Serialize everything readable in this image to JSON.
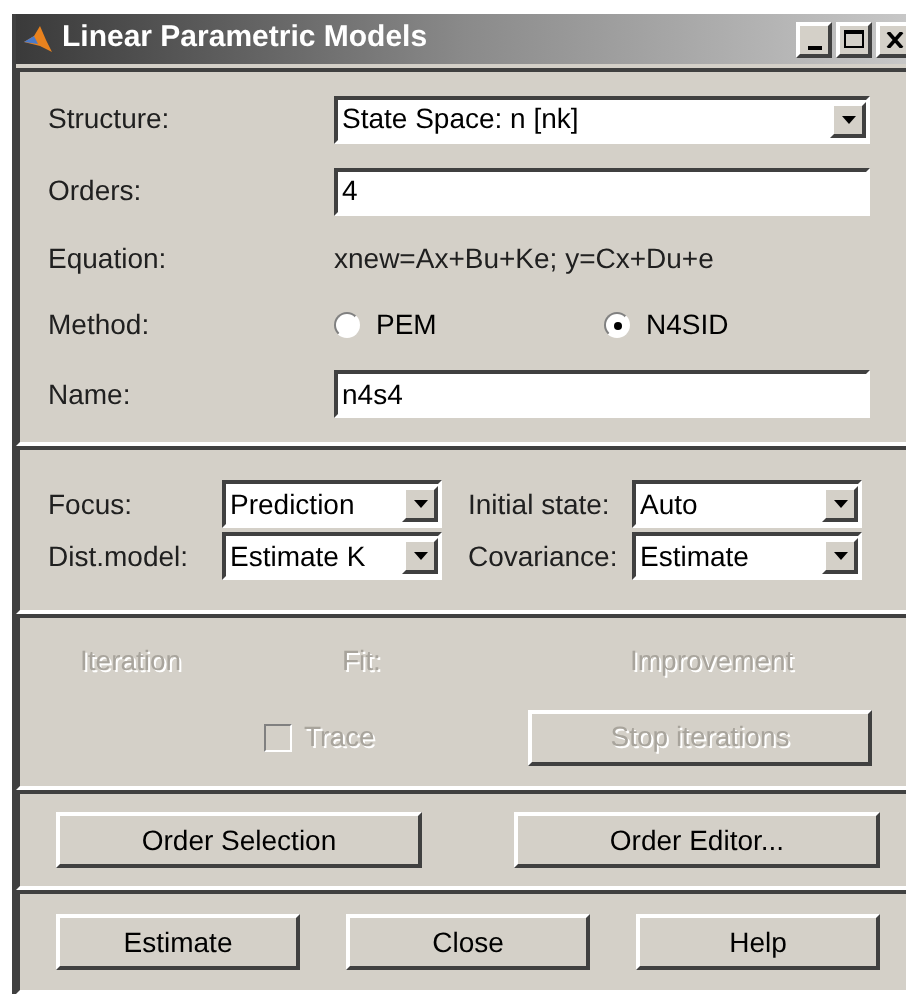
{
  "window": {
    "title": "Linear Parametric Models"
  },
  "model": {
    "rows": [
      {
        "kind": "dropdown",
        "label": "Structure:",
        "value": "State Space: n [nk]"
      },
      {
        "kind": "input",
        "label": "Orders:",
        "value": "4"
      },
      {
        "kind": "text",
        "label": "Equation:",
        "value": "xnew=Ax+Bu+Ke; y=Cx+Du+e"
      },
      {
        "kind": "radio",
        "label": "Method:",
        "options": [
          {
            "label": "PEM",
            "selected": false
          },
          {
            "label": "N4SID",
            "selected": true
          }
        ]
      },
      {
        "kind": "input",
        "label": "Name:",
        "value": "n4s4"
      }
    ]
  },
  "options": [
    {
      "label": "Focus:",
      "value": "Prediction"
    },
    {
      "label": "Initial state:",
      "value": "Auto"
    },
    {
      "label": "Dist.model:",
      "value": "Estimate K"
    },
    {
      "label": "Covariance:",
      "value": "Estimate"
    }
  ],
  "iteration": {
    "disabled": true,
    "labels": [
      "Iteration",
      "Fit:",
      "Improvement"
    ],
    "trace": {
      "label": "Trace",
      "checked": false
    },
    "stop_button": "Stop iterations"
  },
  "order_buttons": [
    "Order Selection",
    "Order Editor..."
  ],
  "buttons": [
    "Estimate",
    "Close",
    "Help"
  ]
}
